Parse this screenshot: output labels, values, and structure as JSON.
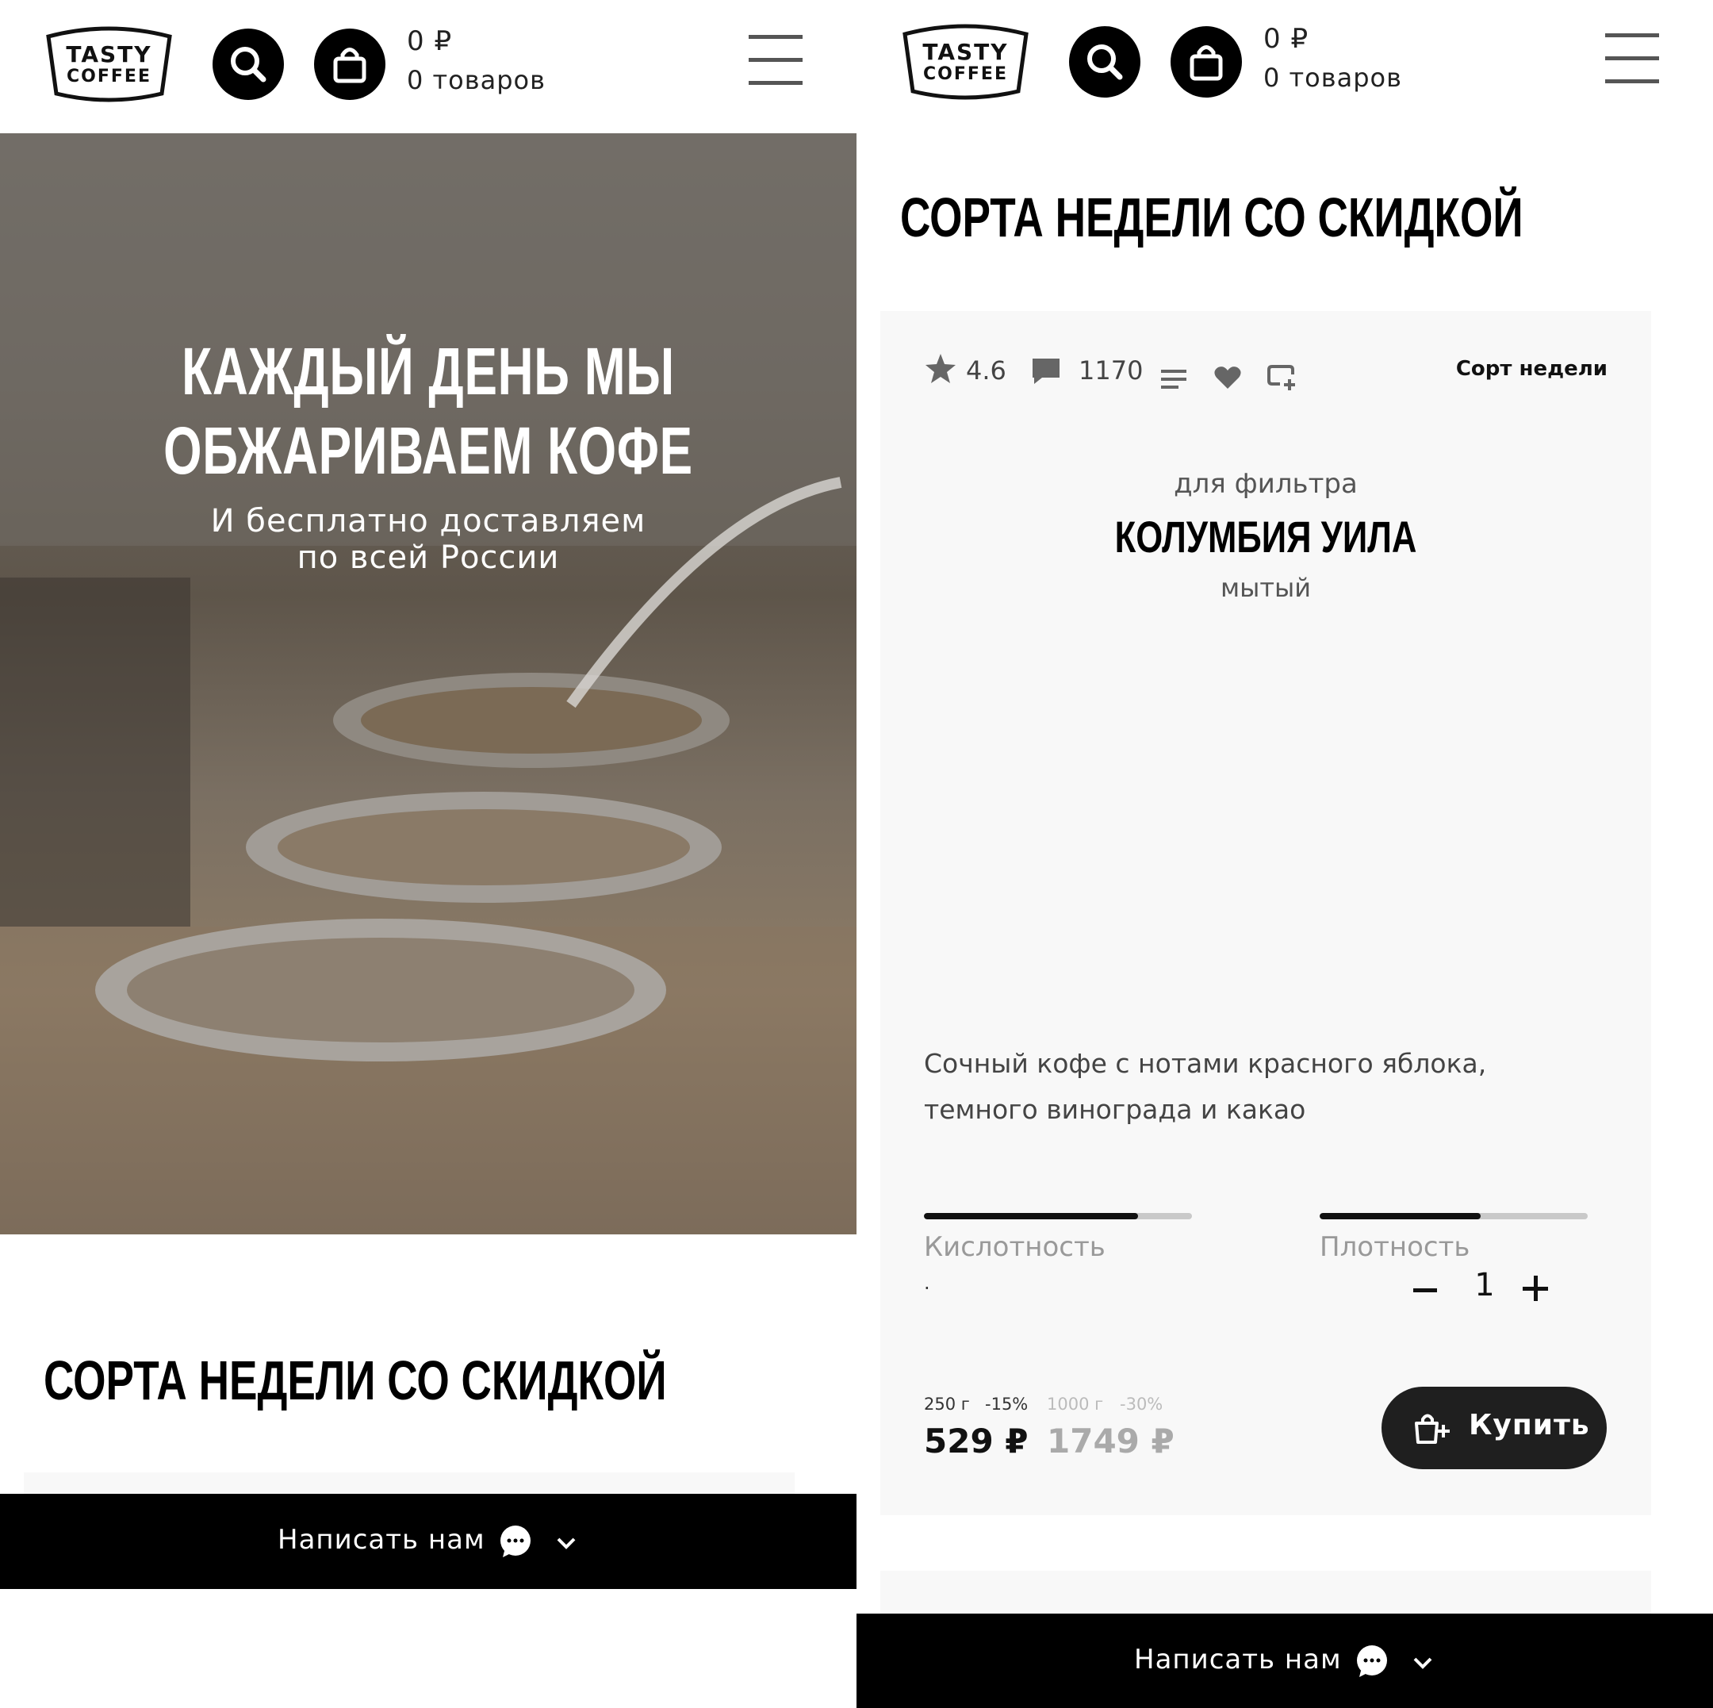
{
  "header": {
    "logo_line1": "TASTY",
    "logo_line2": "COFFEE",
    "cart_sum": "0 ₽",
    "cart_count": "0 товаров"
  },
  "hero": {
    "title_line1": "КАЖДЫЙ ДЕНЬ МЫ",
    "title_line2": "ОБЖАРИВАЕМ КОФЕ",
    "subtitle_line1": "И бесплатно доставляем",
    "subtitle_line2": "по всей России"
  },
  "section_title": "СОРТА НЕДЕЛИ СО СКИДКОЙ",
  "chat": {
    "label": "Написать нам"
  },
  "product": {
    "rating": "4.6",
    "reviews": "1170",
    "badge": "Сорт недели",
    "type": "для фильтра",
    "name": "КОЛУМБИЯ УИЛА",
    "process": "мытый",
    "description": "Сочный кофе с нотами красного яблока, темного винограда и какао",
    "acidity_label": "Кислотность",
    "acidity_level": 0.8,
    "density_label": "Плотность",
    "density_level": 0.6,
    "dot": "·",
    "quantity": "1",
    "weight1": "250 г",
    "discount1": "-15%",
    "weight2": "1000 г",
    "discount2": "-30%",
    "price1": "529 ₽",
    "price2": "1749 ₽",
    "buy_label": "Купить"
  },
  "colors": {
    "accent": "#000000",
    "card_bg": "#f8f8f8",
    "muted_text": "#999999"
  }
}
